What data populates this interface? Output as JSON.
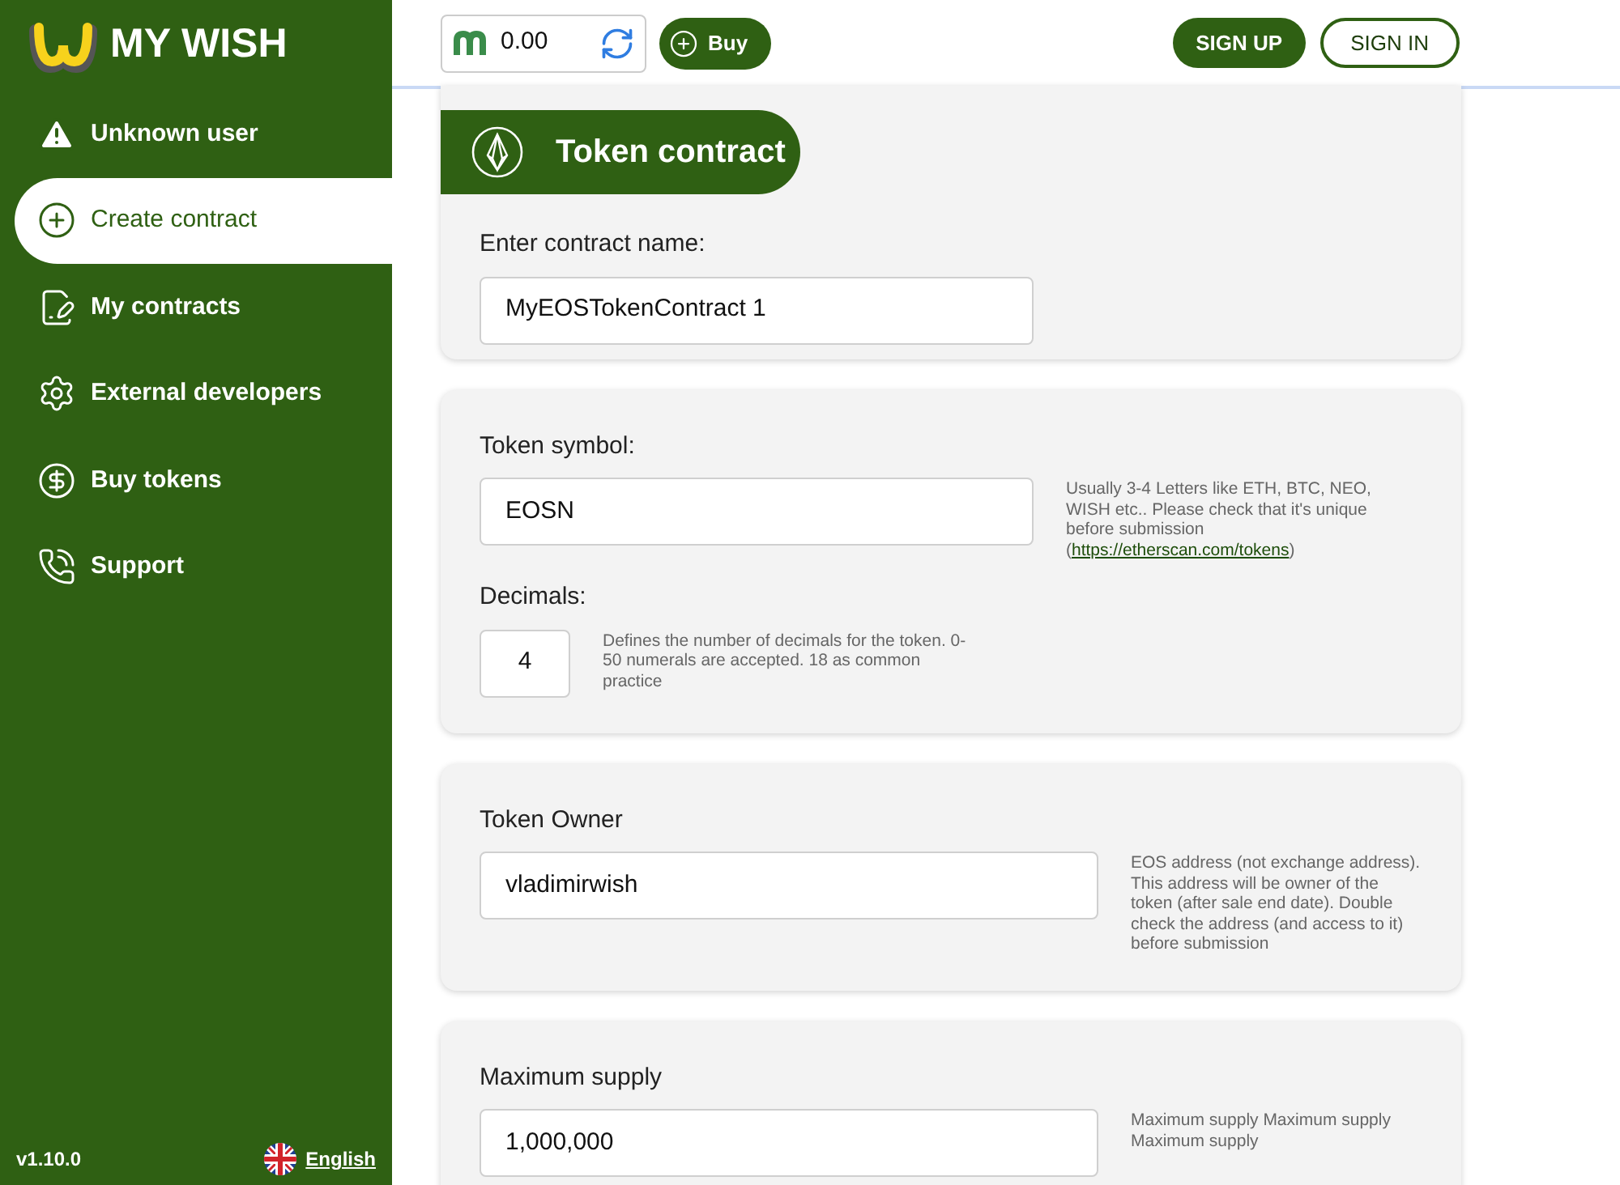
{
  "brand": {
    "name": "MY WISH"
  },
  "balance": {
    "value": "0.00"
  },
  "buy_button": "Buy",
  "auth": {
    "sign_up": "SIGN UP",
    "sign_in": "SIGN IN"
  },
  "sidebar": {
    "items": [
      {
        "label": "Unknown user",
        "kind": "warning",
        "selected": false
      },
      {
        "label": "Create contract",
        "kind": "plus",
        "selected": true
      },
      {
        "label": "My contracts",
        "kind": "contract",
        "selected": false
      },
      {
        "label": "External developers",
        "kind": "gear",
        "selected": false
      },
      {
        "label": "Buy tokens",
        "kind": "dollar",
        "selected": false
      },
      {
        "label": "Support",
        "kind": "phone",
        "selected": false
      }
    ],
    "version": "v1.10.0",
    "language": "English"
  },
  "cards": [
    {
      "title": "Token contract",
      "fields": [
        {
          "label": "Enter contract name:",
          "value": "MyEOSTokenContract 1",
          "kind": "name"
        }
      ]
    },
    {
      "fields": [
        {
          "label": "Token symbol:",
          "value": "EOSN",
          "kind": "symbol",
          "hint": "Usually 3-4 Letters like ETH, BTC, NEO, WISH etc.. Please check that it's unique before submission (",
          "hint_link": "https://etherscan.com/tokens",
          "hint_after": ")"
        },
        {
          "label": "Decimals:",
          "value": "4",
          "kind": "number",
          "hint": "Defines the number of decimals for the token. 0-50 numerals are accepted. 18 as common practice"
        }
      ]
    },
    {
      "fields": [
        {
          "label": "Token Owner",
          "value": "vladimirwish",
          "kind": "address",
          "hint": "EOS address (not exchange address). This address will be owner of the token (after sale end date). Double check the address (and access to it) before submission"
        }
      ]
    },
    {
      "fields": [
        {
          "label": "Maximum supply",
          "value": "1,000,000",
          "kind": "amount",
          "hint": "Maximum supply Maximum supply Maximum supply"
        }
      ]
    }
  ]
}
